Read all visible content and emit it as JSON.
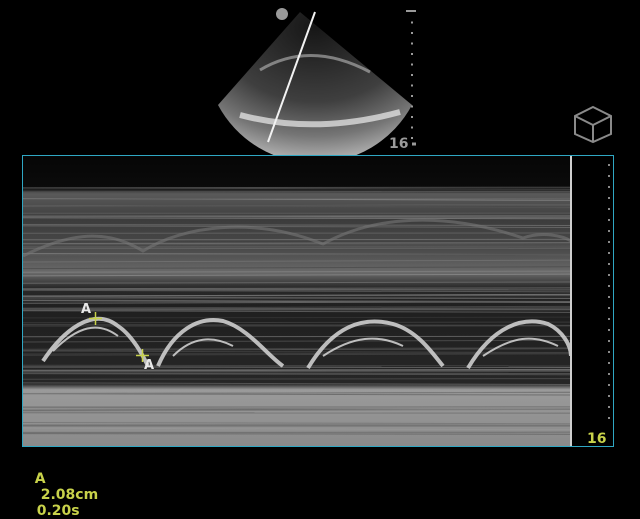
{
  "sector_view": {
    "depth_value": "16"
  },
  "mmode": {
    "depth_value": "16",
    "caliper_marker_top": "A",
    "caliper_marker_bottom": "A"
  },
  "measurement": {
    "label": "A",
    "distance": "2.08cm",
    "time": "0.20s"
  },
  "colors": {
    "accent_teal": "#2fa7c3",
    "measurement_yellow": "#c8d24a",
    "scale_gray": "#9a9a9a"
  },
  "icons": [
    "orientation-marker-icon",
    "3d-cube-icon",
    "caliper-cross-icon"
  ]
}
